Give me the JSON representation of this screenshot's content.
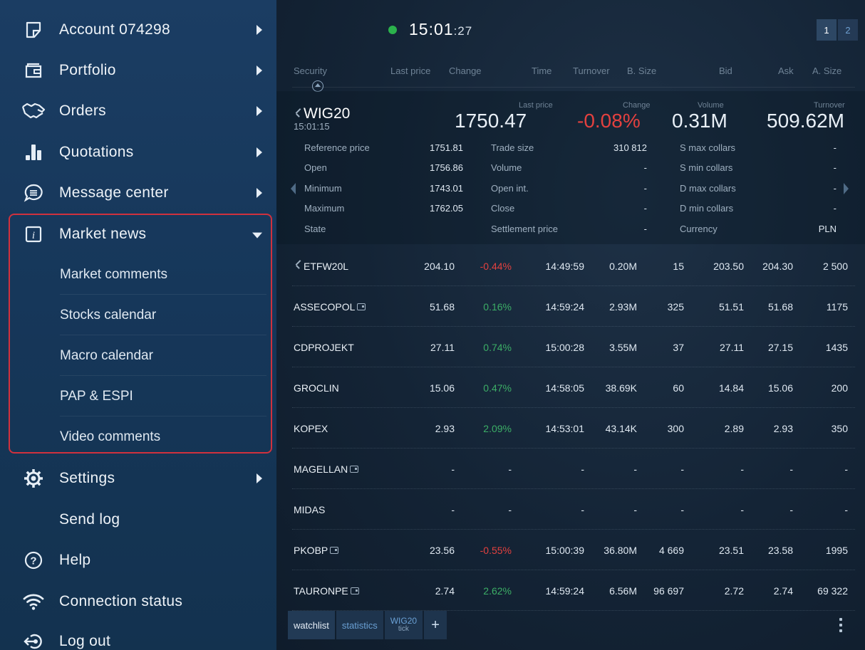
{
  "sidebar": {
    "items": [
      {
        "label": "Account 074298",
        "icon": "account-icon"
      },
      {
        "label": "Portfolio",
        "icon": "wallet-icon"
      },
      {
        "label": "Orders",
        "icon": "handshake-icon"
      },
      {
        "label": "Quotations",
        "icon": "bar-chart-icon"
      },
      {
        "label": "Message center",
        "icon": "chat-icon"
      },
      {
        "label": "Market news",
        "icon": "info-icon"
      },
      {
        "label": "Settings",
        "icon": "gear-icon"
      },
      {
        "label": "Send log",
        "icon": ""
      },
      {
        "label": "Help",
        "icon": "help-icon"
      },
      {
        "label": "Connection status",
        "icon": "wifi-icon"
      },
      {
        "label": "Log out",
        "icon": "logout-icon"
      }
    ],
    "market_news_sub": [
      "Market comments",
      "Stocks calendar",
      "Macro calendar",
      "PAP & ESPI",
      "Video comments"
    ]
  },
  "topbar": {
    "time_main": "15:0",
    "time_mid": "1",
    "time_sec": ":27",
    "pages": [
      "1",
      "2"
    ]
  },
  "columns": [
    "Security",
    "Last price",
    "Change",
    "Time",
    "Turnover",
    "B. Size",
    "Bid",
    "Ask",
    "A. Size"
  ],
  "detail": {
    "name": "WIG20",
    "time": "15:01:15",
    "cap_last": "Last price",
    "last_price": "1750.47",
    "cap_change": "Change",
    "change": "-0.08%",
    "cap_volume": "Volume",
    "volume": "0.31M",
    "cap_turnover": "Turnover",
    "turnover": "509.62M",
    "col1": [
      {
        "label": "Reference price",
        "value": "1751.81"
      },
      {
        "label": "Open",
        "value": "1756.86"
      },
      {
        "label": "Minimum",
        "value": "1743.01"
      },
      {
        "label": "Maximum",
        "value": "1762.05"
      },
      {
        "label": "State",
        "value": ""
      }
    ],
    "col2": [
      {
        "label": "Trade size",
        "value": "310 812"
      },
      {
        "label": "Volume",
        "value": "-"
      },
      {
        "label": "Open int.",
        "value": "-"
      },
      {
        "label": "Close",
        "value": "-"
      },
      {
        "label": "Settlement price",
        "value": "-"
      }
    ],
    "col3": [
      {
        "label": "S max collars",
        "value": "-"
      },
      {
        "label": "S min collars",
        "value": "-"
      },
      {
        "label": "D max collars",
        "value": "-"
      },
      {
        "label": "D min collars",
        "value": "-"
      },
      {
        "label": "Currency",
        "value": "PLN"
      }
    ]
  },
  "rows": [
    {
      "symbol": "ETFW20L",
      "pinned": true,
      "wallet": false,
      "last": "204.10",
      "change": "-0.44%",
      "dir": "neg",
      "time": "14:49:59",
      "turnover": "0.20M",
      "bsize": "15",
      "bid": "203.50",
      "ask": "204.30",
      "asize": "2 500"
    },
    {
      "symbol": "ASSECOPOL",
      "pinned": false,
      "wallet": true,
      "last": "51.68",
      "change": "0.16%",
      "dir": "pos",
      "time": "14:59:24",
      "turnover": "2.93M",
      "bsize": "325",
      "bid": "51.51",
      "ask": "51.68",
      "asize": "1175"
    },
    {
      "symbol": "CDPROJEKT",
      "pinned": false,
      "wallet": false,
      "last": "27.11",
      "change": "0.74%",
      "dir": "pos",
      "time": "15:00:28",
      "turnover": "3.55M",
      "bsize": "37",
      "bid": "27.11",
      "ask": "27.15",
      "asize": "1435"
    },
    {
      "symbol": "GROCLIN",
      "pinned": false,
      "wallet": false,
      "last": "15.06",
      "change": "0.47%",
      "dir": "pos",
      "time": "14:58:05",
      "turnover": "38.69K",
      "bsize": "60",
      "bid": "14.84",
      "ask": "15.06",
      "asize": "200"
    },
    {
      "symbol": "KOPEX",
      "pinned": false,
      "wallet": false,
      "last": "2.93",
      "change": "2.09%",
      "dir": "pos",
      "time": "14:53:01",
      "turnover": "43.14K",
      "bsize": "300",
      "bid": "2.89",
      "ask": "2.93",
      "asize": "350"
    },
    {
      "symbol": "MAGELLAN",
      "pinned": false,
      "wallet": true,
      "last": "-",
      "change": "-",
      "dir": "none",
      "time": "-",
      "turnover": "-",
      "bsize": "-",
      "bid": "-",
      "ask": "-",
      "asize": "-"
    },
    {
      "symbol": "MIDAS",
      "pinned": false,
      "wallet": false,
      "last": "-",
      "change": "-",
      "dir": "none",
      "time": "-",
      "turnover": "-",
      "bsize": "-",
      "bid": "-",
      "ask": "-",
      "asize": "-"
    },
    {
      "symbol": "PKOBP",
      "pinned": false,
      "wallet": true,
      "last": "23.56",
      "change": "-0.55%",
      "dir": "neg",
      "time": "15:00:39",
      "turnover": "36.80M",
      "bsize": "4 669",
      "bid": "23.51",
      "ask": "23.58",
      "asize": "1995"
    },
    {
      "symbol": "TAURONPE",
      "pinned": false,
      "wallet": true,
      "last": "2.74",
      "change": "2.62%",
      "dir": "pos",
      "time": "14:59:24",
      "turnover": "6.56M",
      "bsize": "96 697",
      "bid": "2.72",
      "ask": "2.74",
      "asize": "69 322"
    }
  ],
  "tabs": {
    "watchlist": "watchlist",
    "statistics": "statistics",
    "wig20_top": "WIG20",
    "wig20_bottom": "tick",
    "plus": "+"
  },
  "colors": {
    "negative": "#e3413f",
    "positive": "#3cae66",
    "highlight_border": "#d0313d",
    "clock_dot": "#2bb24c"
  }
}
